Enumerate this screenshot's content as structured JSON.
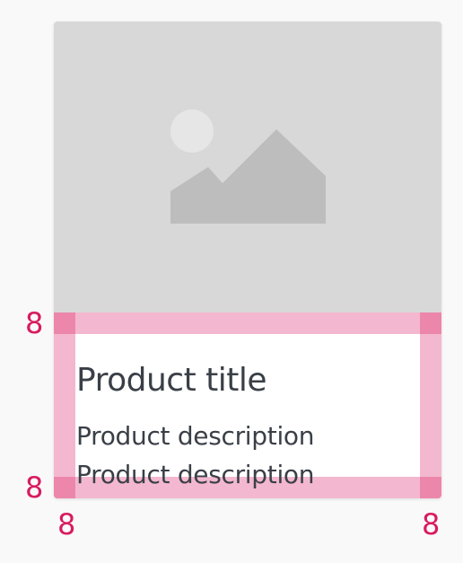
{
  "card": {
    "title": "Product title",
    "description_lines": [
      "Product description",
      "Product description"
    ]
  },
  "media": {
    "icon": "image-placeholder-icon"
  },
  "spacing_labels": {
    "top": "8",
    "bottom": "8",
    "left": "8",
    "right": "8"
  },
  "colors": {
    "background": "#f9f9f9",
    "media_placeholder": "#d8d8d8",
    "padding_highlight": "#f3b8cf",
    "corner_highlight": "#ec86ab",
    "spec_text": "#d81b60",
    "text": "#3a3f47"
  }
}
